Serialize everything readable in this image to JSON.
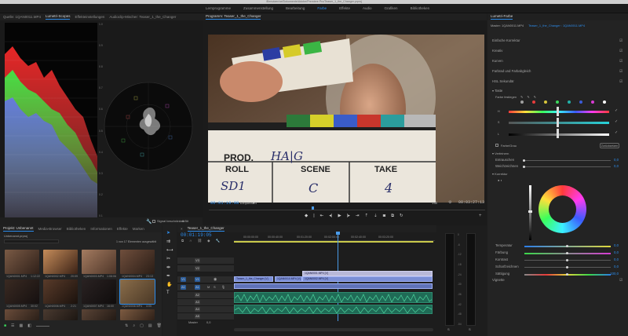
{
  "titlebar": {
    "path": "/Benutzer/ue/Dokumente/Adobe/Premiere Pro/Teaser_1_the_Changer.prproj"
  },
  "workspaces": [
    "Lernprogramme",
    "Zusammenstellung",
    "Bearbeitung",
    "Farbe",
    "Effekte",
    "Audio",
    "Grafiken",
    "Bibliotheken"
  ],
  "active_workspace": "Farbe",
  "source_tabs": {
    "quelle": "Quelle: 1QAN0011.MP4",
    "lumetri_scopes": "Lumetri-Scopes",
    "effekteinstellungen": "Effekteinstellungen",
    "audioclip_mischer": "Audioclip-Mischer: Teaser_1_the_Changer"
  },
  "scopes": {
    "parade_labels": [
      "100",
      "90",
      "80",
      "70",
      "60",
      "50",
      "40",
      "30",
      "20",
      "10",
      "0"
    ],
    "right_labels": [
      "1.0",
      "0.9",
      "0.8",
      "0.7",
      "0.6",
      "0.5",
      "0.4",
      "0.3",
      "0.2",
      "0.1"
    ],
    "bottom_bar": {
      "signal_label": "Signal beschränken",
      "bit_depth": "8 Bit"
    }
  },
  "program": {
    "title": "Programm: Teaser_1_the_Changer",
    "timecode": "00:01:19:08",
    "fit": "Einpassen",
    "resolution": "Voll",
    "duration": "00:03:27:13",
    "slate": {
      "prod_label": "PROD.",
      "roll_label": "ROLL",
      "scene_label": "SCENE",
      "take_label": "TAKE",
      "prod_hand": "HA|G",
      "roll_hand": "SD1",
      "scene_hand": "C",
      "take_hand": "4"
    }
  },
  "project": {
    "tabs": [
      "Projekt: Unbenannt",
      "Media-Browser",
      "Bibliotheken",
      "Informationen",
      "Effekte",
      "Marken"
    ],
    "file": "Unbenannt.prproj",
    "count": "1 von 17 Elementen ausgewählt",
    "items": [
      {
        "name": "1QAN0001.MP4",
        "dur": "1:12:22"
      },
      {
        "name": "1QAN0002.MP4",
        "dur": "20:09"
      },
      {
        "name": "1QAN0003.MP4",
        "dur": "1:08:06"
      },
      {
        "name": "1QAN0004.MP4",
        "dur": "23:13"
      },
      {
        "name": "1QAN0005.MP4",
        "dur": "30:02"
      },
      {
        "name": "1QAN0006.MP4",
        "dur": "2:21"
      },
      {
        "name": "1QAN0007.MP4",
        "dur": "16:00"
      },
      {
        "name": "1QAN0008.MP4",
        "dur": "4:05"
      },
      {
        "name": "",
        "dur": ""
      },
      {
        "name": "",
        "dur": ""
      },
      {
        "name": "",
        "dur": ""
      },
      {
        "name": "",
        "dur": ""
      }
    ]
  },
  "timeline": {
    "title": "Teaser_1_the_Changer",
    "timecode": "00:01:19:05",
    "ticks": [
      "00:00:00:00",
      "00:00:40:00",
      "00:01:20:00",
      "00:02:00:00",
      "00:02:40:00",
      "00:03:20:00"
    ],
    "tracks": [
      "V3",
      "V2",
      "V1",
      "A1",
      "A2",
      "A3",
      "A4",
      "A5"
    ],
    "master_label": "Master",
    "master_value": "0,0",
    "clips_v": [
      "1QAN0001.MP4 [V]",
      "Teaser_1_the_Changer [V]",
      "1QAN0010.MP4 [V]",
      "1QAN0002.MP4 [V]"
    ]
  },
  "meters": {
    "scale": [
      "0",
      "-6",
      "-12",
      "-18",
      "-24",
      "-30",
      "-36",
      "-42",
      "-48",
      "-54"
    ],
    "solo": [
      "S",
      "S"
    ]
  },
  "lumetri": {
    "title": "Lumetri-Farbe",
    "master": "Master: 1QAN0011.MP4",
    "sequence": "Teaser_1_the_Changer : 1QAN0011.MP4",
    "sections": [
      "Einfache Korrektur",
      "Kreativ",
      "Kurven",
      "Farbrad und Farbabgleich",
      "HSL Sekundär"
    ],
    "taste_label": "Taste",
    "farbe_festlegen": "Farbe festlegen",
    "channels": [
      "H",
      "S",
      "L"
    ],
    "farbe_grau": "Farbe/Grau",
    "zuruecksetzen": "Zurücksetzen",
    "verfeinern": "Verfeinern",
    "refine": [
      {
        "label": "Entrauschen",
        "value": "0,0"
      },
      {
        "label": "Weichzeichnen",
        "value": "0,0"
      }
    ],
    "korrektur": "Korrektur",
    "adjust": [
      {
        "label": "Temperatur",
        "value": "0,0"
      },
      {
        "label": "Färbung",
        "value": "0,0"
      },
      {
        "label": "Kontrast",
        "value": "0,0"
      },
      {
        "label": "Scharfzeichnen",
        "value": "0,0"
      },
      {
        "label": "Sättigung",
        "value": "100,0"
      }
    ],
    "vignette": "Vignette",
    "swatch_colors": [
      "#d7d7d7",
      "#e63b3b",
      "#d8d43b",
      "#3bd85b",
      "#3bd8d4",
      "#3b5bd8",
      "#d83bd4",
      "#ffffff"
    ]
  },
  "colors": {
    "accent": "#2d8ceb",
    "playhead": "#4a9be8",
    "clip_video": "#7b8fd6",
    "clip_audio": "#1f6b56"
  }
}
